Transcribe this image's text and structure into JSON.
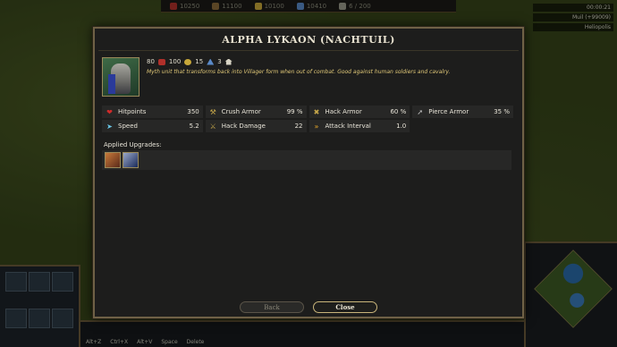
{
  "top_bar": {
    "resources": [
      {
        "value": "10250",
        "icon": "food-icon",
        "color": "#b0302a"
      },
      {
        "value": "11100",
        "icon": "wood-icon",
        "color": "#8a6a3a"
      },
      {
        "value": "10100",
        "icon": "gold-icon",
        "color": "#c8a83a"
      },
      {
        "value": "10410",
        "icon": "favor-icon",
        "color": "#5a8ac8"
      },
      {
        "value": "6 / 200",
        "icon": "population-icon",
        "color": "#9a9a8a"
      }
    ]
  },
  "right_info": {
    "time": "00:00:21",
    "players": [
      "Muil (+99009)",
      "Heliopolis"
    ]
  },
  "hotkeys": [
    "Alt+Z",
    "Ctrl+X",
    "Alt+V",
    "Space",
    "Delete"
  ],
  "dialog": {
    "title": "ALPHA LYKAON (NACHTUIL)",
    "costs": [
      {
        "icon": "food-icon",
        "value": "80"
      },
      {
        "icon": "wood-icon",
        "value": "100"
      },
      {
        "icon": "gold-icon",
        "value": "15"
      },
      {
        "icon": "favor-icon",
        "value": "3"
      },
      {
        "icon": "population-icon",
        "value": ""
      }
    ],
    "description": "Myth unit that transforms back into Villager form when out of combat. Good against human soldiers and cavalry.",
    "stats": [
      {
        "label": "Hitpoints",
        "value": "350",
        "icon": "heart-icon",
        "color": "#d02a2a"
      },
      {
        "label": "Crush Armor",
        "value": "99 %",
        "icon": "crush-armor-icon",
        "color": "#c8a84a"
      },
      {
        "label": "Hack Armor",
        "value": "60 %",
        "icon": "hack-armor-icon",
        "color": "#c8a84a"
      },
      {
        "label": "Pierce Armor",
        "value": "35 %",
        "icon": "pierce-armor-icon",
        "color": "#c8c8c8"
      },
      {
        "label": "Speed",
        "value": "5.2",
        "icon": "speed-icon",
        "color": "#6ac8e8"
      },
      {
        "label": "Hack Damage",
        "value": "22",
        "icon": "hack-damage-icon",
        "color": "#c8a84a"
      },
      {
        "label": "Attack Interval",
        "value": "1.0",
        "icon": "attack-interval-icon",
        "color": "#e8a82a"
      }
    ],
    "upgrades_label": "Applied Upgrades:",
    "upgrades": [
      {
        "icon": "upgrade-claw-icon",
        "color": "#8a4a2a"
      },
      {
        "icon": "upgrade-wolf-icon",
        "color": "#2a3a6a"
      }
    ],
    "back_label": "Back",
    "close_label": "Close"
  }
}
